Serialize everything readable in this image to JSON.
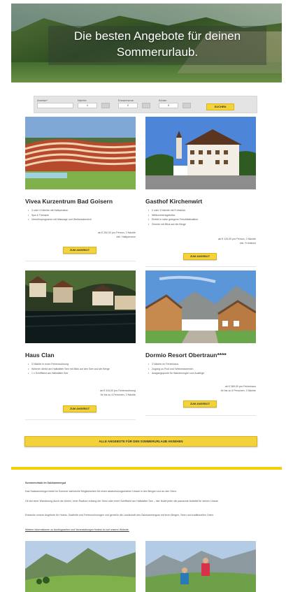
{
  "hero": {
    "title_line1": "Die besten Angebote für deinen",
    "title_line2": "Sommerurlaub."
  },
  "search": {
    "fields": [
      {
        "label": "Anreise*",
        "value": ""
      },
      {
        "label": "Nächte",
        "value": "1"
      },
      {
        "label": "Erwachsene",
        "value": "2"
      },
      {
        "label": "Kinder",
        "value": "0"
      }
    ],
    "submit_label": "SUCHEN"
  },
  "hotels": [
    {
      "name": "Vivea Kurzentrum Bad Goisern",
      "features": [
        "3 oder 4 Nächte mit Halbpension",
        "Spa & Therapie",
        "Verwöhnprogramm mit Massage und Wellnessbereich"
      ],
      "price_line1": "ab € 252,00 pro Person, 3 Nächte",
      "price_line2": "inkl. Halbpension",
      "button_label": "ZUM ANGEBOT"
    },
    {
      "name": "Gasthof Kirchenwirt",
      "features": [
        "2 oder 3 Nächte mit Frühstück",
        "Willkommensgetränk",
        "Eintritt in nahe gelegene Freizeitattraktion",
        "Zimmer mit Blick auf die Berge"
      ],
      "price_line1": "ab € 125,00 pro Person, 2 Nächte",
      "price_line2": "inkl. Frühstück",
      "button_label": "ZUM ANGEBOT"
    },
    {
      "name": "Haus Clan",
      "features": [
        "3 Nächte in einer Ferienwohnung",
        "Wohnen direkt am Hallstätter See mit Blick auf den See und die Berge",
        "1 x Schifffahrt am Hallstätter See"
      ],
      "price_line1": "ab € 315,00 pro Ferienwohnung",
      "price_line2": "für bis zu 4 Personen, 3 Nächte",
      "button_label": "ZUM ANGEBOT"
    },
    {
      "name": "Dormio Resort Obertraun****",
      "features": [
        "3 Nächte im Ferienhaus",
        "Zugang zu Pool und Wellnessbereich",
        "Ausgangspunkt für Wanderungen und Ausflüge"
      ],
      "price_line1": "ab € 389,00 pro Ferienhaus",
      "price_line2": "für bis zu 6 Personen, 3 Nächte",
      "button_label": "ZUM ANGEBOT"
    }
  ],
  "cta_label": "ALLE ANGEBOTE FÜR DEN SOMMERURLAUB ANSEHEN",
  "article": {
    "heading": "Sommerurlaub im Salzkammergut",
    "paragraphs": [
      "Das Salzkammergut bietet im Sommer zahlreiche Möglichkeiten für einen abwechslungsreichen Urlaub in den Bergen und an den Seen.",
      "Ob bei einer Wanderung durch die Almen, einer Radtour entlang der Seen oder einer Schifffahrt am Hallstätter See – hier findet jeder die passende Aktivität für seinen Urlaub.",
      "Entdecke unsere Angebote für Hotels, Gasthöfe und Ferienwohnungen und genieße die Landschaft des Salzkammerguts mit ihren Bergen, Seen und traditionellen Orten.",
      "Weitere Informationen zu Ausflugszielen und Veranstaltungen findest du auf unserer Website."
    ]
  }
}
